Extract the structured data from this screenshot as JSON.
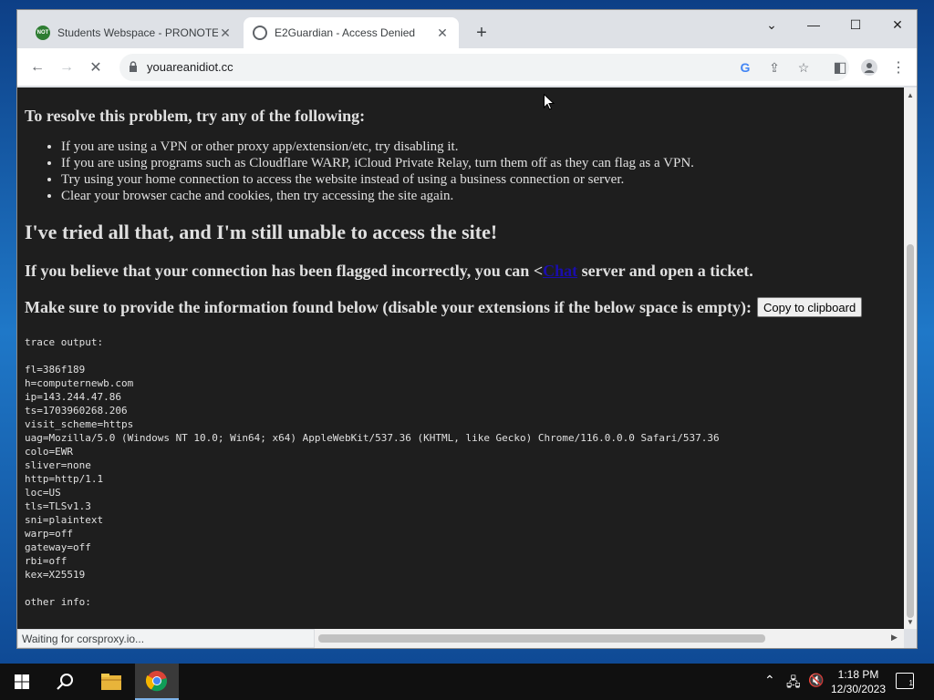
{
  "browser": {
    "tabs": [
      {
        "label": "Students Webspace - PRONOTE",
        "favicon": "NOT"
      },
      {
        "label": "E2Guardian - Access Denied"
      }
    ],
    "url": "youareanidiot.cc",
    "status_text": "Waiting for corsproxy.io..."
  },
  "page": {
    "resolve_heading": "To resolve this problem, try any of the following:",
    "tips": [
      "If you are using a VPN or other proxy app/extension/etc, try disabling it.",
      "If you are using programs such as Cloudflare WARP, iCloud Private Relay, turn them off as they can flag as a VPN.",
      "Try using your home connection to access the website instead of using a business connection or server.",
      "Clear your browser cache and cookies, then try accessing the site again."
    ],
    "still_unable_heading": "I've tried all that, and I'm still unable to access the site!",
    "flagged_text_before": "If you believe that your connection has been flagged incorrectly, you can <",
    "flagged_link": "Chat",
    "flagged_text_after": " server and open a ticket.",
    "info_heading": "Make sure to provide the information found below (disable your extensions if the below space is empty):",
    "copy_button": "Copy to clipboard",
    "trace_output": "trace output:\n\nfl=386f189\nh=computernewb.com\nip=143.244.47.86\nts=1703960268.206\nvisit_scheme=https\nuag=Mozilla/5.0 (Windows NT 10.0; Win64; x64) AppleWebKit/537.36 (KHTML, like Gecko) Chrome/116.0.0.0 Safari/537.36\ncolo=EWR\nsliver=none\nhttp=http/1.1\nloc=US\ntls=TLSv1.3\nsni=plaintext\nwarp=off\ngateway=off\nrbi=off\nkex=X25519\n\nother info:"
  },
  "taskbar": {
    "time": "1:18 PM",
    "date": "12/30/2023",
    "notification_count": "1"
  }
}
